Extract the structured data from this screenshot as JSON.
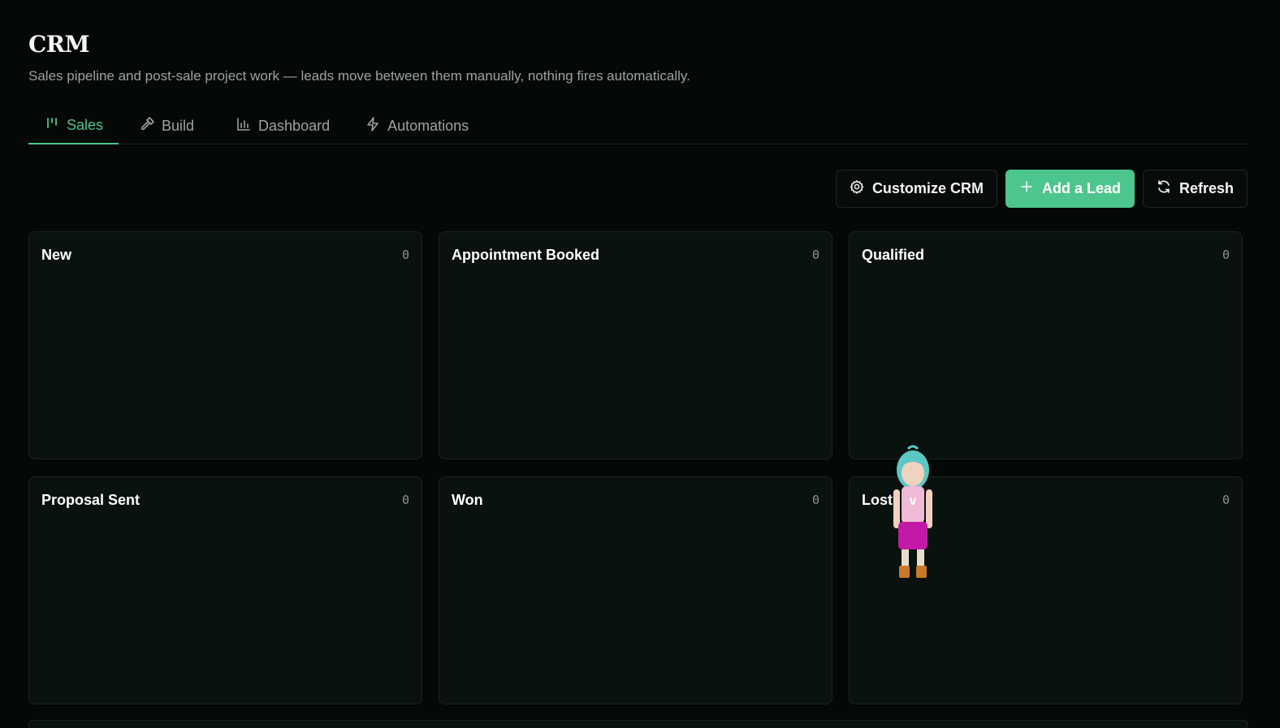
{
  "header": {
    "title": "CRM",
    "subtitle": "Sales pipeline and post-sale project work — leads move between them manually, nothing fires automatically."
  },
  "tabs": [
    {
      "label": "Sales",
      "icon": "kanban-icon",
      "active": true
    },
    {
      "label": "Build",
      "icon": "hammer-icon",
      "active": false
    },
    {
      "label": "Dashboard",
      "icon": "bar-chart-icon",
      "active": false
    },
    {
      "label": "Automations",
      "icon": "lightning-icon",
      "active": false
    }
  ],
  "toolbar": {
    "customize_label": "Customize CRM",
    "add_lead_label": "Add a Lead",
    "refresh_label": "Refresh"
  },
  "pipeline": {
    "columns": [
      {
        "title": "New",
        "count": "0"
      },
      {
        "title": "Appointment Booked",
        "count": "0"
      },
      {
        "title": "Qualified",
        "count": "0"
      },
      {
        "title": "Proposal Sent",
        "count": "0"
      },
      {
        "title": "Won",
        "count": "0"
      },
      {
        "title": "Lost",
        "count": "0"
      }
    ]
  },
  "colors": {
    "accent": "#4cc68d",
    "background": "#040806",
    "card": "#0a1210",
    "muted_text": "#9aa3a0"
  }
}
